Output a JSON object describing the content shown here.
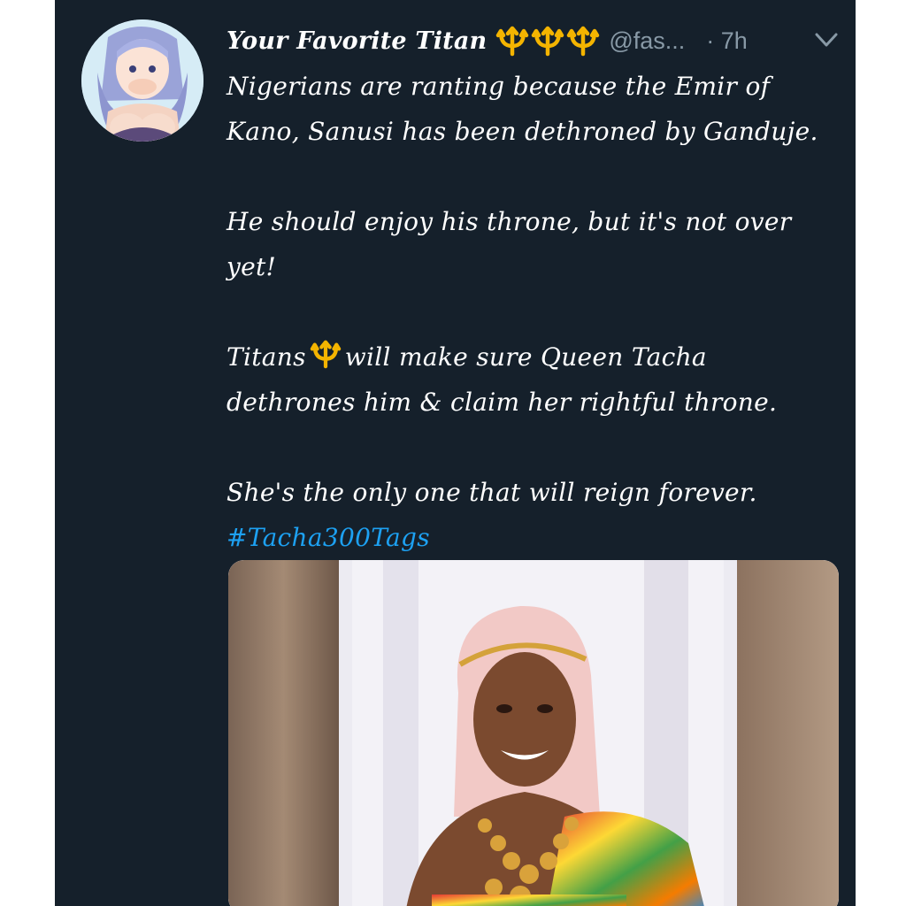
{
  "tweet": {
    "display_name": "Your Favorite Titan",
    "name_emojis": [
      "trident-emoji",
      "trident-emoji",
      "trident-emoji"
    ],
    "handle": "@fas...",
    "separator_time": "· 7h",
    "paragraphs": {
      "p1_line1": "Nigerians are ranting because the Emir of",
      "p1_line2": "Kano, Sanusi has been dethroned by Ganduje.",
      "p2_line1": "He should enjoy his throne, but it's not over",
      "p2_line2": "yet!",
      "p3_before_emoji": "Titans",
      "p3_after_emoji": "will make sure Queen Tacha",
      "p3_line2": "dethrones him & claim her rightful throne.",
      "p4_line1": "She's the only one that will reign forever."
    },
    "hashtag": "#Tacha300Tags"
  },
  "icons": {
    "avatar": "anime-avatar",
    "menu": "chevron-down-icon",
    "emoji": "trident-emoji"
  },
  "colors": {
    "background": "#15202b",
    "text": "#ffffff",
    "muted": "#8899a6",
    "link": "#1da1f2",
    "emoji_gold": "#f4b400"
  }
}
